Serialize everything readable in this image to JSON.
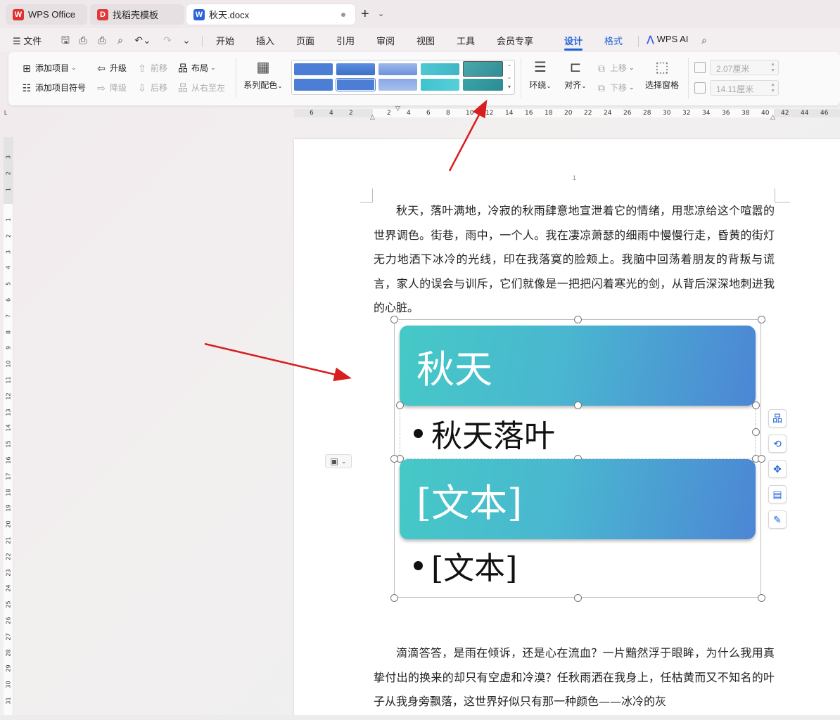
{
  "tabs": [
    {
      "label": "WPS Office",
      "icon": "wps-logo-icon"
    },
    {
      "label": "找稻壳模板",
      "icon": "docer-logo-icon"
    },
    {
      "label": "秋天.docx",
      "icon": "word-doc-icon"
    }
  ],
  "menu": {
    "file": "文件",
    "items": [
      "开始",
      "插入",
      "页面",
      "引用",
      "审阅",
      "视图",
      "工具",
      "会员专享",
      "设计",
      "格式"
    ],
    "active": "设计",
    "ai": "WPS AI"
  },
  "ribbon": {
    "add_item": "添加项目",
    "add_bullet": "添加项目符号",
    "promote": "升级",
    "demote": "降级",
    "move_up": "前移",
    "move_down": "后移",
    "layout": "布局",
    "rtl": "从右至左",
    "colors": "系列配色",
    "wrap": "环绕",
    "align": "对齐",
    "bring_up": "上移",
    "send_down": "下移",
    "selection_pane": "选择窗格",
    "height": "2.07厘米",
    "width": "14.11厘米",
    "gallery_colors": {
      "row1": [
        "#4b7ed4",
        "#4b7ed4",
        "#7e9fe0",
        "#4cc6cf",
        "#3aa4a9"
      ],
      "row2": [
        "#4b7ed4",
        "#4b7ed4",
        "#8aa7e4",
        "#4cc6cf",
        "#3aa4a9"
      ]
    }
  },
  "hruler_ticks": [
    "6",
    "4",
    "2",
    "2",
    "4",
    "6",
    "8",
    "10",
    "12",
    "14",
    "16",
    "18",
    "20",
    "22",
    "24",
    "26",
    "28",
    "30",
    "32",
    "34",
    "36",
    "38",
    "40",
    "42",
    "44",
    "46"
  ],
  "vruler_ticks": [
    "3",
    "2",
    "1",
    "1",
    "2",
    "3",
    "4",
    "5",
    "6",
    "7",
    "8",
    "9",
    "10",
    "11",
    "12",
    "13",
    "14",
    "15",
    "16",
    "17",
    "18",
    "19",
    "20",
    "21",
    "22",
    "23",
    "24",
    "25",
    "26",
    "27",
    "28",
    "29",
    "30",
    "31"
  ],
  "page": {
    "number": "1",
    "para1": "秋天，落叶满地，冷寂的秋雨肆意地宣泄着它的情绪，用悲凉给这个喧嚣的世界调色。街巷，雨中，一个人。我在凄凉萧瑟的细雨中慢慢行走，昏黄的街灯无力地洒下冰冷的光线，印在我落寞的脸颊上。我脑中回荡着朋友的背叛与谎言，家人的误会与训斥，它们就像是一把把闪着寒光的剑，从背后深深地刺进我的心脏。",
    "para2": "滴滴答答，是雨在倾诉，还是心在流血？一片黯然浮于眼眸，为什么我用真挚付出的换来的却只有空虚和冷漠？任秋雨洒在我身上，任枯黄而又不知名的叶子从我身旁飘落，这世界好似只有那一种颜色——冰冷的灰"
  },
  "smartart": {
    "header1": "秋天",
    "bullet1": "秋天落叶",
    "header2": "[文本]",
    "bullet2": "[文本]",
    "gradient": [
      "#45c9c6",
      "#4c86d5"
    ]
  },
  "colors": {
    "accent": "#1c62d8",
    "arrow": "#d81e1e"
  }
}
